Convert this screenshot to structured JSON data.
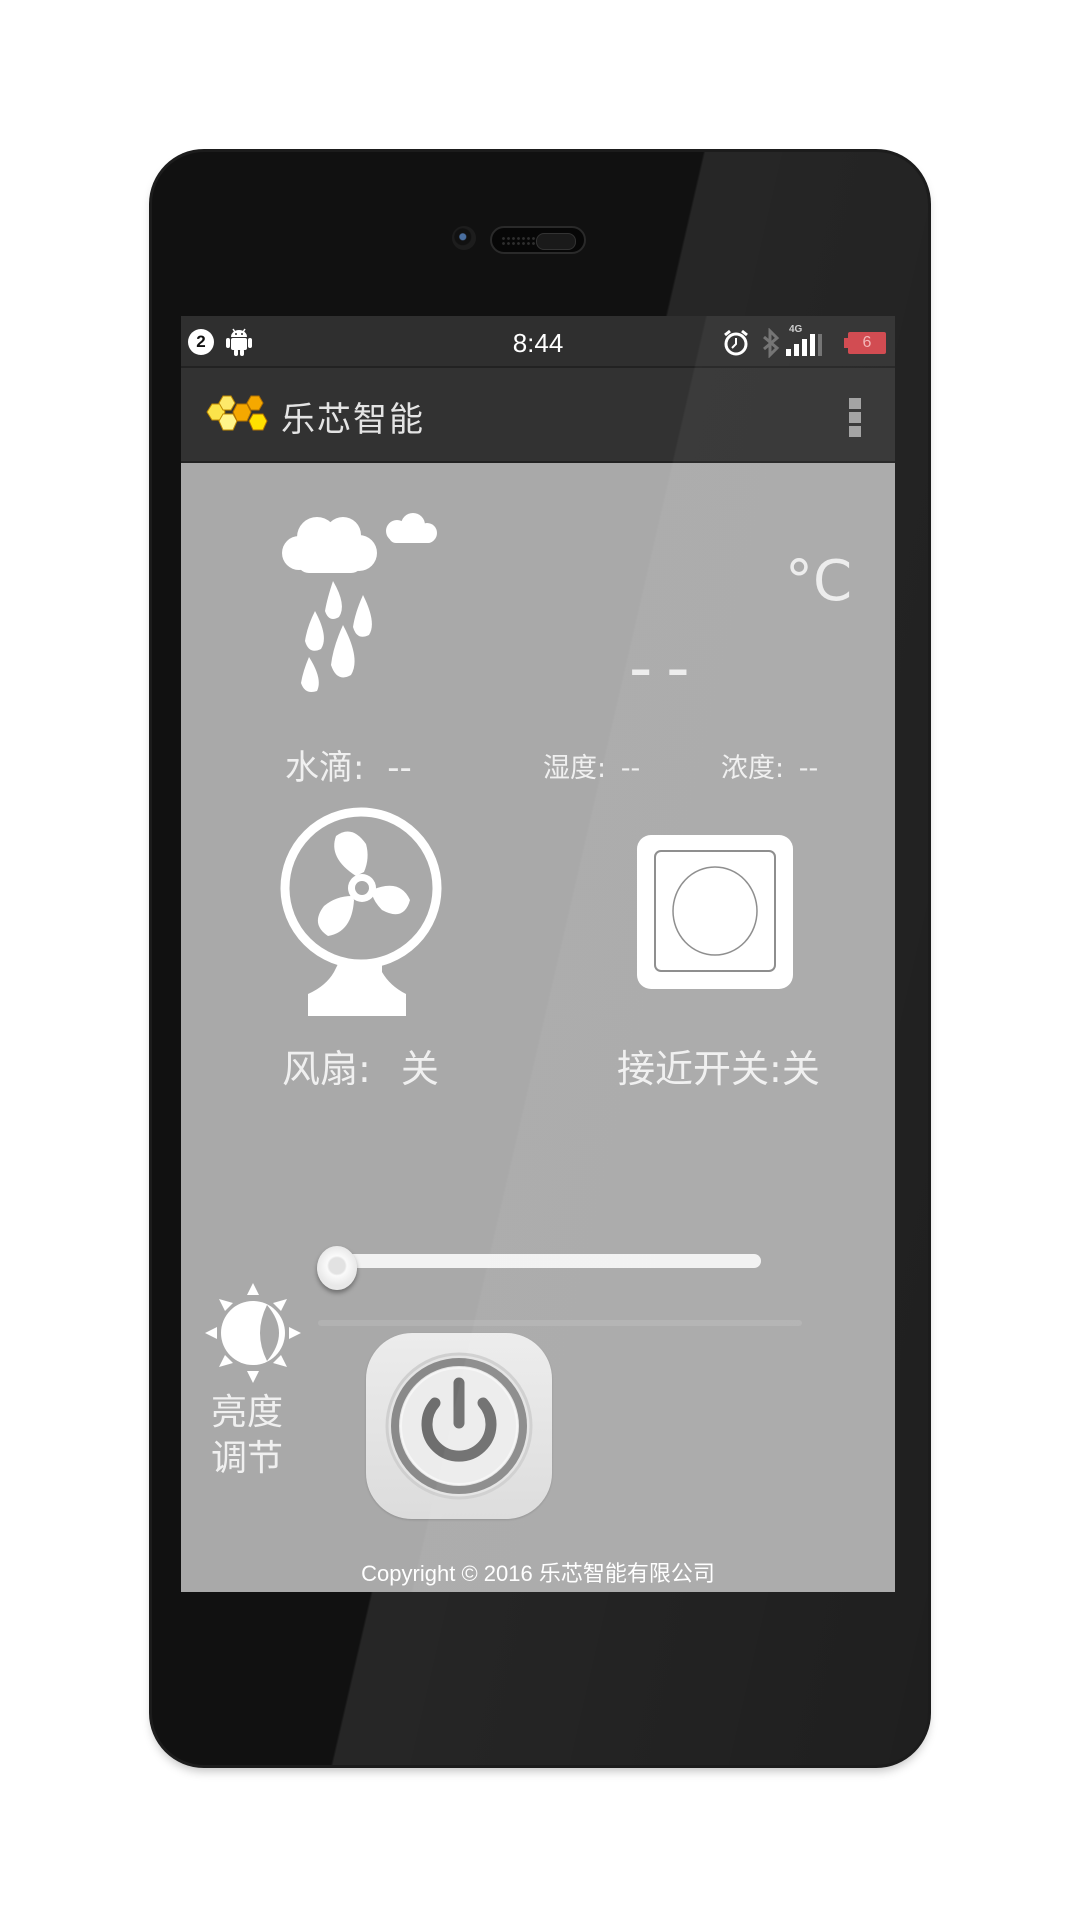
{
  "status_bar": {
    "notification_count": "2",
    "time": "8:44",
    "network_type": "4G",
    "battery_level": "6",
    "icons": [
      "notification-count-icon",
      "android-icon",
      "alarm-icon",
      "bluetooth-icon",
      "signal-icon",
      "battery-icon"
    ]
  },
  "app_bar": {
    "title": "乐芯智能",
    "logo_icon": "honeycomb-logo-icon",
    "menu_icon": "overflow-menu-icon"
  },
  "weather": {
    "icon": "rain-cloud-icon",
    "temperature": "--",
    "temperature_unit": "°C",
    "water_drop_label": "水滴:",
    "water_drop_value": "--",
    "humidity_label": "湿度:",
    "humidity_value": "--",
    "concentration_label": "浓度:",
    "concentration_value": "--"
  },
  "devices": {
    "fan_label": "风扇:",
    "fan_state": "关",
    "proximity_switch_label": "接近开关:",
    "proximity_switch_state": "关"
  },
  "brightness": {
    "label_line1": "亮度",
    "label_line2": "调节",
    "icon": "brightness-icon",
    "value_percent": 0
  },
  "power": {
    "icon": "power-icon"
  },
  "footer": {
    "copyright": "Copyright © 2016 乐芯智能有限公司"
  },
  "colors": {
    "screen_bg": "#a9a9a9",
    "bar_bg": "#2f2f2f",
    "battery_red": "#d0454b",
    "logo_yellow": "#f5a800"
  }
}
